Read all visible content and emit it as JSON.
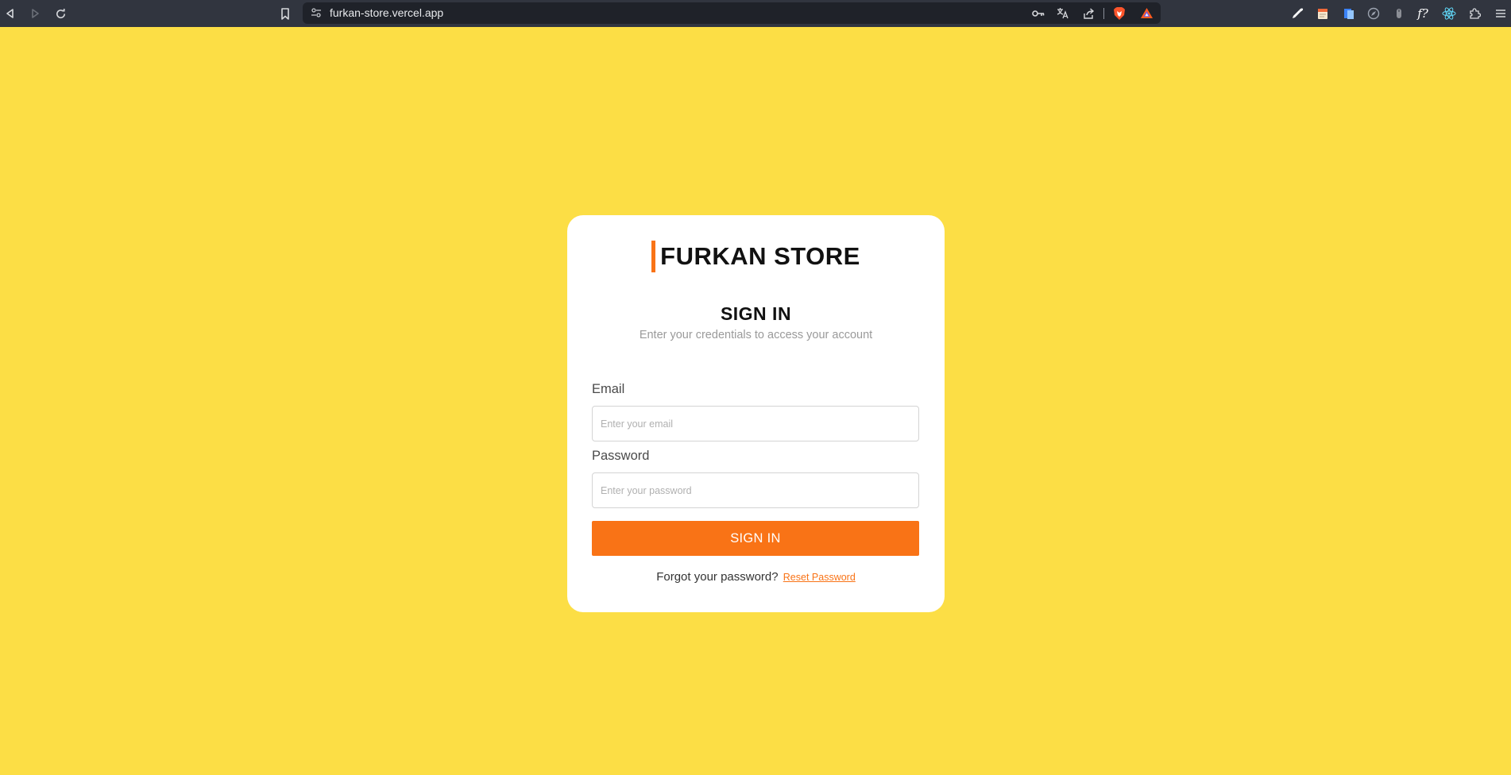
{
  "browser": {
    "url": "furkan-store.vercel.app",
    "icons": {
      "back": "back-icon",
      "forward": "forward-icon",
      "reload": "reload-icon",
      "bookmark": "bookmark-icon",
      "site_info": "site-settings-icon",
      "password": "key-icon",
      "translate": "translate-icon",
      "share": "share-icon",
      "brave_shields": "brave-shields-icon",
      "brave_rewards": "brave-rewards-icon",
      "extensions": [
        "eyedropper-icon",
        "notes-icon",
        "document-icon",
        "compass-icon",
        "mouse-icon",
        "font-icon",
        "react-icon",
        "puzzle-icon",
        "menu-icon"
      ]
    },
    "font_extension_label": "f?"
  },
  "login": {
    "brand": "FURKAN STORE",
    "title": "SIGN IN",
    "subtitle": "Enter your credentials to access your account",
    "email_label": "Email",
    "email_placeholder": "Enter your email",
    "email_value": "",
    "password_label": "Password",
    "password_placeholder": "Enter your password",
    "password_value": "",
    "submit_label": "SIGN IN",
    "forgot_text": "Forgot your password?",
    "reset_label": "Reset Password"
  },
  "colors": {
    "background": "#fcde45",
    "accent": "#f97316",
    "card": "#ffffff",
    "chrome": "#31353f"
  }
}
